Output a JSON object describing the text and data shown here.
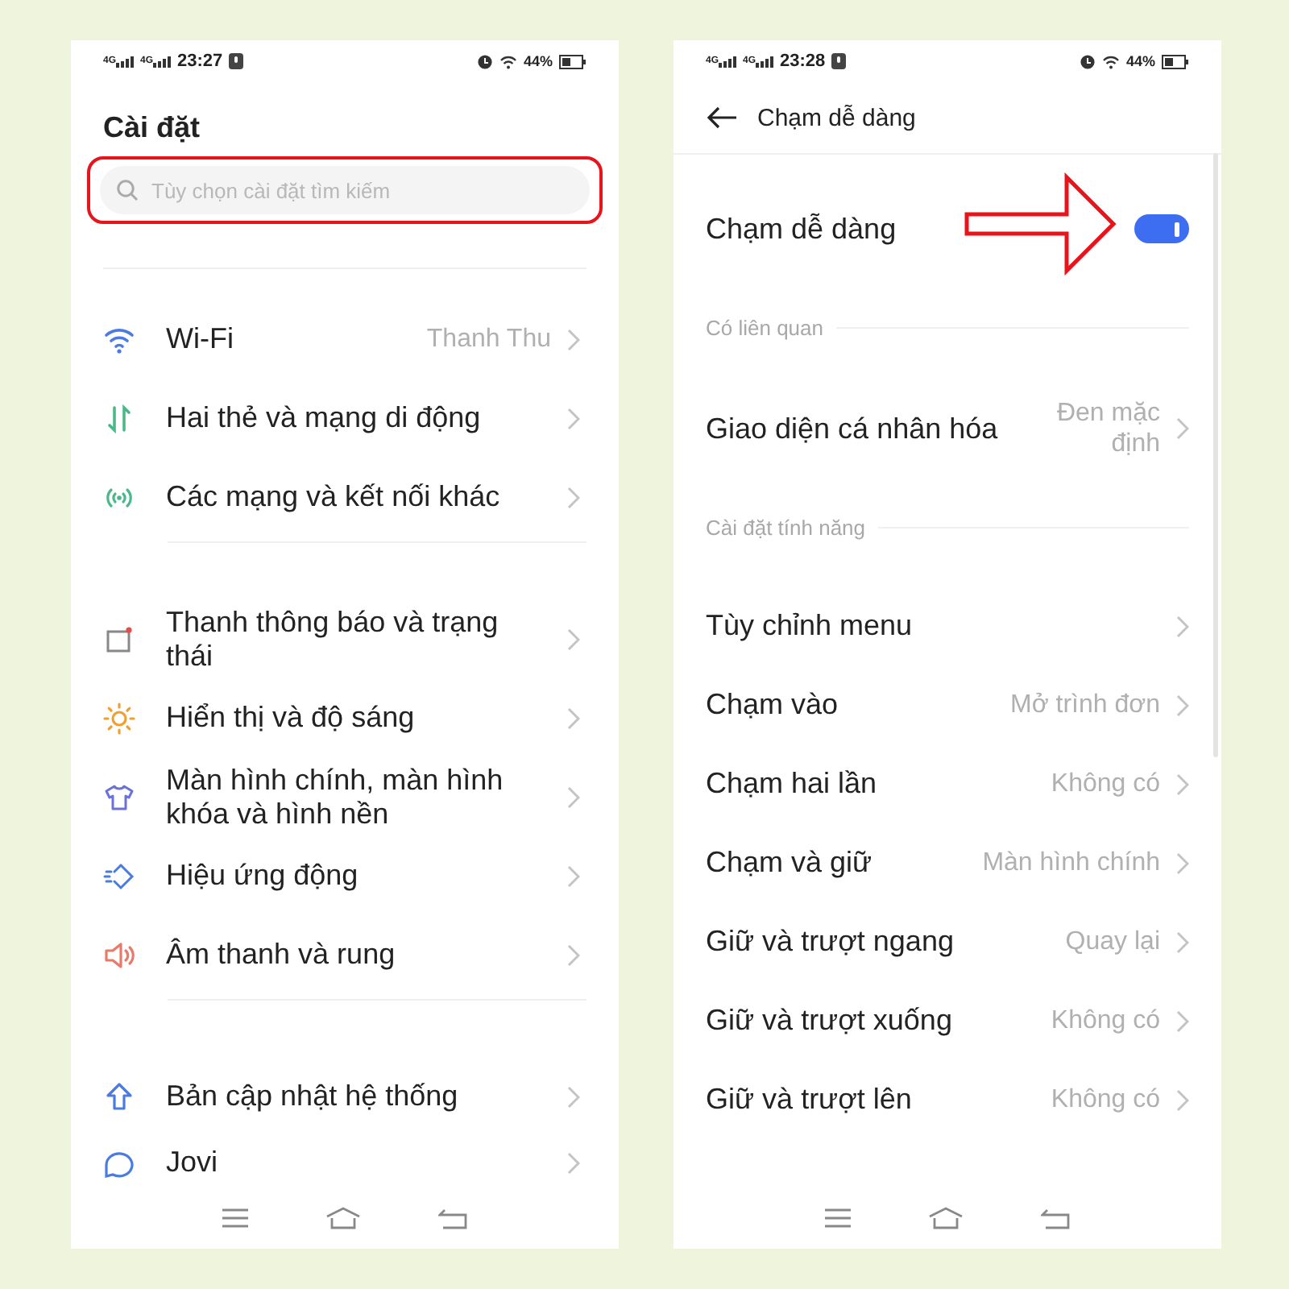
{
  "screens": [
    {
      "status_bar": {
        "networks": [
          "4G",
          "4G"
        ],
        "time": "23:27",
        "battery": "44%"
      },
      "title": "Cài đặt",
      "search": {
        "placeholder": "Tùy chọn cài đặt tìm kiếm",
        "highlighted": true
      },
      "groups": [
        {
          "items": [
            {
              "label": "Wi-Fi",
              "value": "Thanh Thu"
            },
            {
              "label": "Hai thẻ và mạng di động"
            },
            {
              "label": "Các mạng và kết nối khác"
            }
          ]
        },
        {
          "items": [
            {
              "label": "Thanh thông báo và trạng thái"
            },
            {
              "label": "Hiển thị và độ sáng"
            },
            {
              "label": "Màn hình chính, màn hình khóa và hình nền"
            },
            {
              "label": "Hiệu ứng động"
            },
            {
              "label": "Âm thanh và rung"
            }
          ]
        },
        {
          "items": [
            {
              "label": "Bản cập nhật hệ thống"
            },
            {
              "label": "Jovi"
            }
          ]
        }
      ]
    },
    {
      "status_bar": {
        "networks": [
          "4G",
          "4G"
        ],
        "time": "23:28",
        "battery": "44%"
      },
      "header": {
        "title": "Chạm dễ dàng"
      },
      "toggle": {
        "label": "Chạm dễ dàng",
        "on": true,
        "pointed_at": true
      },
      "sections": [
        {
          "heading": "Có liên quan",
          "items": [
            {
              "label": "Giao diện cá nhân hóa",
              "value": "Đen mặc định"
            }
          ]
        },
        {
          "heading": "Cài đặt tính năng",
          "items": [
            {
              "label": "Tùy chỉnh menu"
            },
            {
              "label": "Chạm vào",
              "value": "Mở trình đơn"
            },
            {
              "label": "Chạm hai lần",
              "value": "Không có"
            },
            {
              "label": "Chạm và giữ",
              "value": "Màn hình chính"
            },
            {
              "label": "Giữ và trượt ngang",
              "value": "Quay lại"
            },
            {
              "label": "Giữ và trượt xuống",
              "value": "Không có"
            },
            {
              "label": "Giữ và trượt lên",
              "value": "Không có"
            }
          ]
        }
      ]
    }
  ]
}
